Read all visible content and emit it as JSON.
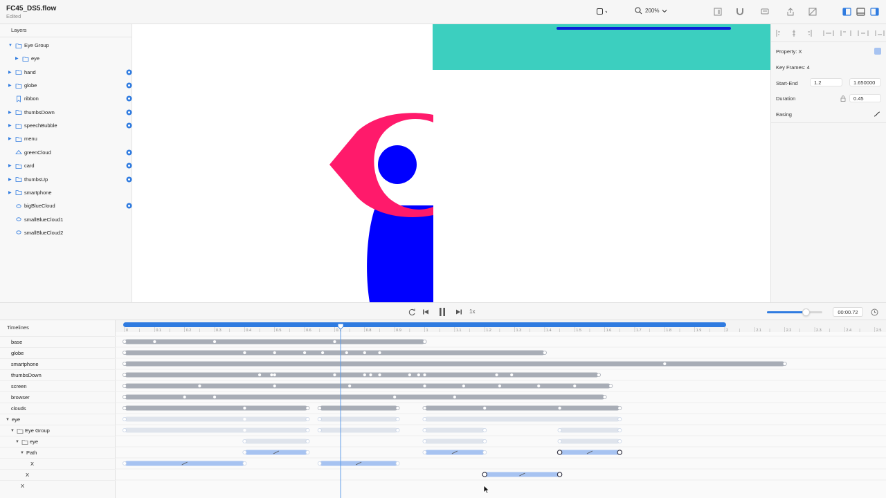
{
  "document": {
    "title": "FC45_DS5.flow",
    "status": "Edited"
  },
  "toolbar": {
    "zoom": "200%"
  },
  "layers_panel": {
    "title": "Layers",
    "items": [
      {
        "name": "Eye Group",
        "indent": 0,
        "arrow": "down",
        "icon": "folder-icon",
        "visible_toggle": false
      },
      {
        "name": "eye",
        "indent": 1,
        "arrow": "right",
        "icon": "folder-icon",
        "visible_toggle": false
      },
      {
        "name": "hand",
        "indent": 0,
        "arrow": "right",
        "icon": "folder-icon",
        "visible_toggle": true
      },
      {
        "name": "globe",
        "indent": 0,
        "arrow": "right",
        "icon": "folder-icon",
        "visible_toggle": true
      },
      {
        "name": "ribbon",
        "indent": 0,
        "arrow": "",
        "icon": "ribbon-icon",
        "visible_toggle": true
      },
      {
        "name": "thumbsDown",
        "indent": 0,
        "arrow": "right",
        "icon": "folder-icon",
        "visible_toggle": true
      },
      {
        "name": "speechBubble",
        "indent": 0,
        "arrow": "right",
        "icon": "folder-icon",
        "visible_toggle": true
      },
      {
        "name": "menu",
        "indent": 0,
        "arrow": "right",
        "icon": "folder-icon",
        "visible_toggle": false
      },
      {
        "name": "greenCloud",
        "indent": 0,
        "arrow": "",
        "icon": "cloud-icon",
        "visible_toggle": true
      },
      {
        "name": "card",
        "indent": 0,
        "arrow": "right",
        "icon": "folder-icon",
        "visible_toggle": true
      },
      {
        "name": "thumbsUp",
        "indent": 0,
        "arrow": "right",
        "icon": "folder-icon",
        "visible_toggle": true
      },
      {
        "name": "smartphone",
        "indent": 0,
        "arrow": "right",
        "icon": "folder-icon",
        "visible_toggle": false
      },
      {
        "name": "bigBlueCloud",
        "indent": 0,
        "arrow": "",
        "icon": "shape-icon",
        "visible_toggle": true
      },
      {
        "name": "smallBlueCloud1",
        "indent": 0,
        "arrow": "",
        "icon": "shape-icon",
        "visible_toggle": false
      },
      {
        "name": "smallBlueCloud2",
        "indent": 0,
        "arrow": "",
        "icon": "shape-icon",
        "visible_toggle": false
      }
    ]
  },
  "inspector": {
    "property_label": "Property: X",
    "keyframes_label": "Key Frames: 4",
    "start_end_label": "Start-End",
    "start_value": "1.2",
    "end_value": "1.650000",
    "duration_label": "Duration",
    "duration_value": "0.45",
    "easing_label": "Easing"
  },
  "playback": {
    "speed": "1x",
    "time": "00:00.72",
    "volume": 0.7
  },
  "timelines": {
    "title": "Timelines",
    "ruler_ticks": [
      "0",
      "0.1",
      "0.2",
      "0.3",
      "0.4",
      "0.5",
      "0.6",
      "0.7",
      "0.8",
      "0.9",
      "1",
      "1.1",
      "1.2",
      "1.3",
      "1.4",
      "1.5",
      "1.6",
      "1.7",
      "1.8",
      "1.9",
      "2",
      "2.1",
      "2.2",
      "2.3",
      "2.4",
      "2.5"
    ],
    "work_area_end": 2.0,
    "playhead": 0.72,
    "rows": [
      {
        "name": "base",
        "indent": 0,
        "arrow": ""
      },
      {
        "name": "globe",
        "indent": 0,
        "arrow": ""
      },
      {
        "name": "smartphone",
        "indent": 0,
        "arrow": ""
      },
      {
        "name": "thumbsDown",
        "indent": 0,
        "arrow": ""
      },
      {
        "name": "screen",
        "indent": 0,
        "arrow": ""
      },
      {
        "name": "browser",
        "indent": 0,
        "arrow": ""
      },
      {
        "name": "clouds",
        "indent": 0,
        "arrow": ""
      },
      {
        "name": "eye",
        "indent": 0,
        "arrow": "down"
      },
      {
        "name": "Eye Group",
        "indent": 1,
        "arrow": "down",
        "icon": "folder-icon"
      },
      {
        "name": "eye",
        "indent": 2,
        "arrow": "down",
        "icon": "folder-icon"
      },
      {
        "name": "Path",
        "indent": 3,
        "arrow": "down"
      },
      {
        "name": "X",
        "indent": 4,
        "arrow": ""
      },
      {
        "name": "X",
        "indent": 3,
        "arrow": ""
      },
      {
        "name": "X",
        "indent": 2,
        "arrow": ""
      }
    ],
    "bars": [
      {
        "row": 0,
        "kind": "gray",
        "start": 0,
        "end": 1.0,
        "keys": [
          0.1,
          0.3,
          0.7
        ]
      },
      {
        "row": 1,
        "kind": "gray",
        "start": 0,
        "end": 1.4,
        "keys": [
          0.4,
          0.5,
          0.6,
          0.66,
          0.74,
          0.8,
          0.85
        ]
      },
      {
        "row": 2,
        "kind": "gray",
        "start": 0,
        "end": 2.2,
        "keys": [
          1.8
        ]
      },
      {
        "row": 3,
        "kind": "gray",
        "start": 0,
        "end": 1.58,
        "keys": [
          0.45,
          0.49,
          0.5,
          0.7,
          0.8,
          0.82,
          0.85,
          0.95,
          0.98,
          1.0,
          1.24,
          1.29
        ]
      },
      {
        "row": 4,
        "kind": "gray",
        "start": 0,
        "end": 1.62,
        "keys": [
          0.25,
          0.5,
          0.75,
          1.0,
          1.13,
          1.25,
          1.38,
          1.5
        ]
      },
      {
        "row": 5,
        "kind": "gray",
        "start": 0,
        "end": 1.6,
        "keys": [
          0.2,
          0.3,
          0.9,
          1.1
        ]
      },
      {
        "row": 6,
        "kind": "gray",
        "start": 0,
        "end": 0.61,
        "keys": [
          0.4
        ]
      },
      {
        "row": 6,
        "kind": "gray",
        "start": 0.65,
        "end": 0.91,
        "keys": []
      },
      {
        "row": 6,
        "kind": "gray",
        "start": 1.0,
        "end": 1.65,
        "keys": [
          1.2,
          1.45
        ]
      },
      {
        "row": 7,
        "kind": "faint",
        "start": 0,
        "end": 0.61,
        "keys": [
          0.4
        ]
      },
      {
        "row": 7,
        "kind": "faint",
        "start": 0.65,
        "end": 0.91,
        "keys": []
      },
      {
        "row": 7,
        "kind": "faint",
        "start": 1.0,
        "end": 1.65,
        "keys": []
      },
      {
        "row": 8,
        "kind": "faint",
        "start": 0,
        "end": 0.61,
        "keys": [
          0.4
        ]
      },
      {
        "row": 8,
        "kind": "faint",
        "start": 0.65,
        "end": 0.91,
        "keys": []
      },
      {
        "row": 8,
        "kind": "faint",
        "start": 1.0,
        "end": 1.2,
        "keys": []
      },
      {
        "row": 8,
        "kind": "faint",
        "start": 1.45,
        "end": 1.65,
        "keys": []
      },
      {
        "row": 9,
        "kind": "faint",
        "start": 0.4,
        "end": 0.61,
        "keys": []
      },
      {
        "row": 9,
        "kind": "faint",
        "start": 1.0,
        "end": 1.2,
        "keys": []
      },
      {
        "row": 9,
        "kind": "faint",
        "start": 1.45,
        "end": 1.65,
        "keys": []
      },
      {
        "row": 10,
        "kind": "blue",
        "start": 0.4,
        "end": 0.61,
        "keys": [],
        "ease": true
      },
      {
        "row": 10,
        "kind": "blue",
        "start": 1.0,
        "end": 1.2,
        "keys": [],
        "ease": true
      },
      {
        "row": 10,
        "kind": "blue",
        "start": 1.45,
        "end": 1.65,
        "keys": [],
        "ease": true,
        "selected": true
      },
      {
        "row": 11,
        "kind": "blue",
        "start": 0,
        "end": 0.4,
        "keys": [],
        "ease": true
      },
      {
        "row": 11,
        "kind": "blue",
        "start": 0.65,
        "end": 0.91,
        "keys": [],
        "ease": true
      },
      {
        "row": 12,
        "kind": "blue",
        "start": 1.2,
        "end": 1.45,
        "keys": [],
        "ease": true,
        "selected": true
      }
    ]
  },
  "colors": {
    "accent": "#2f7be0",
    "teal": "#3ccfbf",
    "pink": "#ff1a6b",
    "eye_blue": "#0000ff",
    "bar_gray": "#a8adb6",
    "bar_faint": "#dfe4ec",
    "bar_blue": "#a7c3f1"
  }
}
